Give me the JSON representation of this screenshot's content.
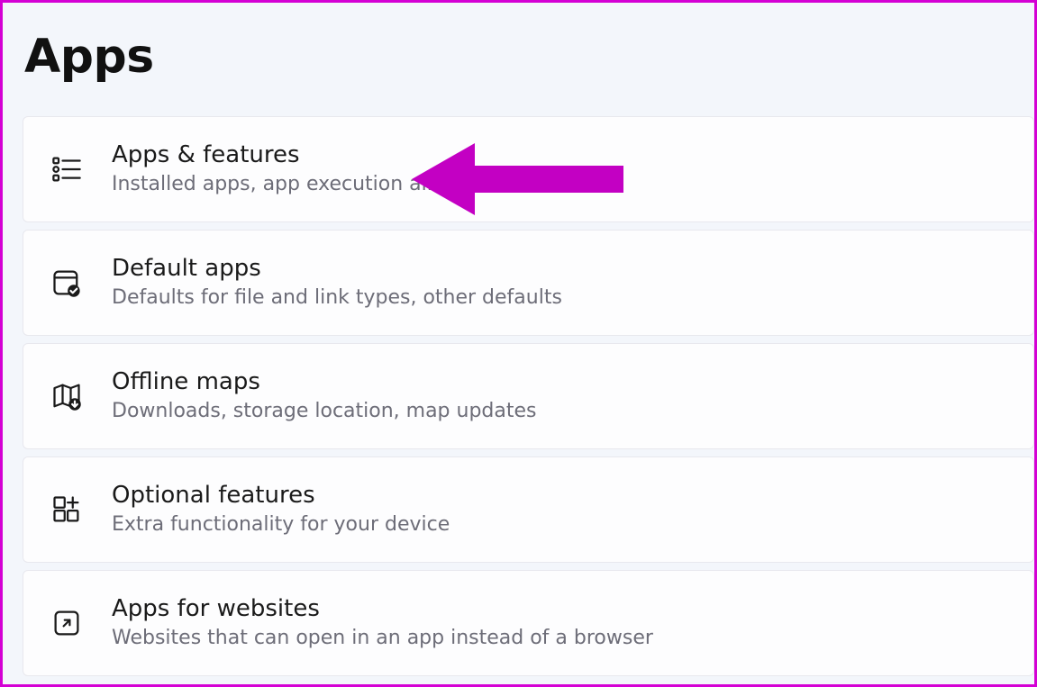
{
  "page": {
    "title": "Apps"
  },
  "items": [
    {
      "id": "apps-features",
      "title": "Apps & features",
      "sub": "Installed apps, app execution aliases"
    },
    {
      "id": "default-apps",
      "title": "Default apps",
      "sub": "Defaults for file and link types, other defaults"
    },
    {
      "id": "offline-maps",
      "title": "Offline maps",
      "sub": "Downloads, storage location, map updates"
    },
    {
      "id": "optional-features",
      "title": "Optional features",
      "sub": "Extra functionality for your device"
    },
    {
      "id": "apps-for-websites",
      "title": "Apps for websites",
      "sub": "Websites that can open in an app instead of a browser"
    }
  ],
  "annotation": {
    "color": "#c300c3"
  }
}
